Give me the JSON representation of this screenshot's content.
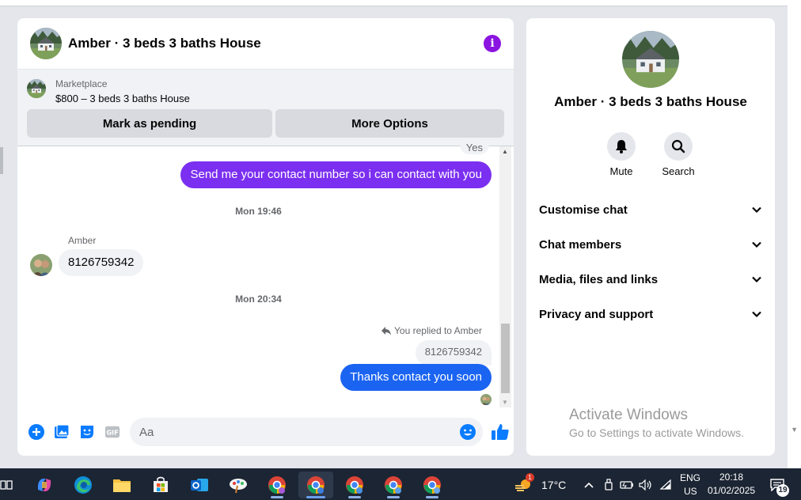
{
  "chat": {
    "title": "Amber · 3 beds 3 baths House",
    "marketplace_label": "Marketplace",
    "listing": "$800 – 3 beds 3 baths House",
    "buttons": {
      "pending": "Mark as pending",
      "more": "More Options"
    }
  },
  "messages": {
    "fragment": "Yes",
    "outgoing_1": "Send me your contact number so i can contact with you",
    "timestamp_1": "Mon 19:46",
    "sender": "Amber",
    "incoming_1": "8126759342",
    "timestamp_2": "Mon 20:34",
    "reply_note": "You replied to Amber",
    "reply_quote": "8126759342",
    "outgoing_2": "Thanks contact you soon"
  },
  "composer": {
    "placeholder": "Aa"
  },
  "info": {
    "name": "Amber · 3 beds 3 baths House",
    "actions": {
      "mute": "Mute",
      "search": "Search"
    },
    "sections": [
      "Customise chat",
      "Chat members",
      "Media, files and links",
      "Privacy and support"
    ]
  },
  "watermark": {
    "line1": "Activate Windows",
    "line2": "Go to Settings to activate Windows."
  },
  "taskbar": {
    "weather_temp": "17°C",
    "weather_badge": "1",
    "lang_1": "ENG",
    "lang_2": "US",
    "time": "20:18",
    "date": "01/02/2025",
    "notifications": "19"
  },
  "colors": {
    "accent_purple": "#7b2ff0",
    "accent_blue": "#1b64f2",
    "messenger_blue": "#0a7cff",
    "info_purple": "#8a14e0"
  }
}
